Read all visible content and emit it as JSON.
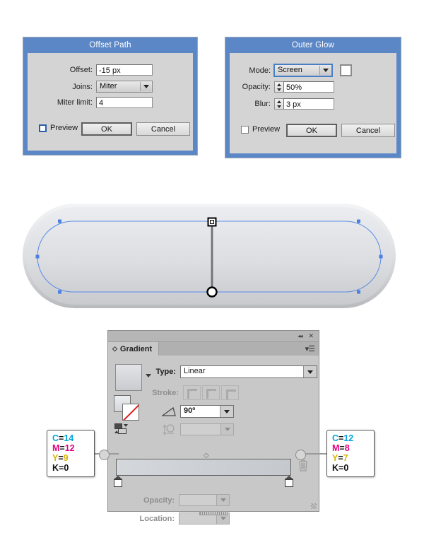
{
  "offset_path_dialog": {
    "title": "Offset Path",
    "fields": [
      {
        "label": "Offset:",
        "value": "-15 px",
        "type": "text"
      },
      {
        "label": "Joins:",
        "value": "Miter",
        "type": "combo"
      },
      {
        "label": "Miter limit:",
        "value": "4",
        "type": "text"
      }
    ],
    "preview_label": "Preview",
    "ok_label": "OK",
    "cancel_label": "Cancel"
  },
  "outer_glow_dialog": {
    "title": "Outer Glow",
    "mode_label": "Mode:",
    "mode_value": "Screen",
    "opacity_label": "Opacity:",
    "opacity_value": "50%",
    "blur_label": "Blur:",
    "blur_value": "3 px",
    "preview_label": "Preview",
    "ok_label": "OK",
    "cancel_label": "Cancel",
    "glow_color": "#ffffff"
  },
  "artwork": {
    "name": "rounded-stadium-shape",
    "fill_top": "#e9ebee",
    "fill_bottom": "#cfcfd2",
    "path_color": "#4b7fe0",
    "anchor_color": "#4b7fe0"
  },
  "gradient_panel": {
    "tab_label": "Gradient",
    "collapse_icon": "◂◂",
    "close_icon": "✕",
    "menu_icon": "menu",
    "type_label": "Type:",
    "type_value": "Linear",
    "stroke_label": "Stroke:",
    "angle_label": "angle",
    "angle_value": "90º",
    "reverse_label": "reverse",
    "reverse_value": "",
    "opacity_label": "Opacity:",
    "opacity_value": "",
    "location_label": "Location:",
    "location_value": "",
    "delete_icon": "trash-icon",
    "gradient_start_color": "#d3d6da",
    "gradient_end_color": "#c3c7cc"
  },
  "callouts": {
    "left": {
      "name": "left-gradient-stop-color",
      "c_key": "C",
      "c_val": "14",
      "m_key": "M",
      "m_val": "12",
      "y_key": "Y",
      "y_val": "9",
      "k_key": "K",
      "k_val": "0",
      "eq": "="
    },
    "right": {
      "name": "right-gradient-stop-color",
      "c_key": "C",
      "c_val": "12",
      "m_key": "M",
      "m_val": "8",
      "y_key": "Y",
      "y_val": "7",
      "k_key": "K",
      "k_val": "0",
      "eq": "="
    }
  },
  "colors": {
    "title_bar": "#5b87c6",
    "dialog_bg": "#d4d4d4",
    "panel_bg": "#c8c8c8",
    "cyan": "#00a6e0",
    "magenta": "#e5007d",
    "yellow": "#d9b400",
    "black": "#111111"
  }
}
